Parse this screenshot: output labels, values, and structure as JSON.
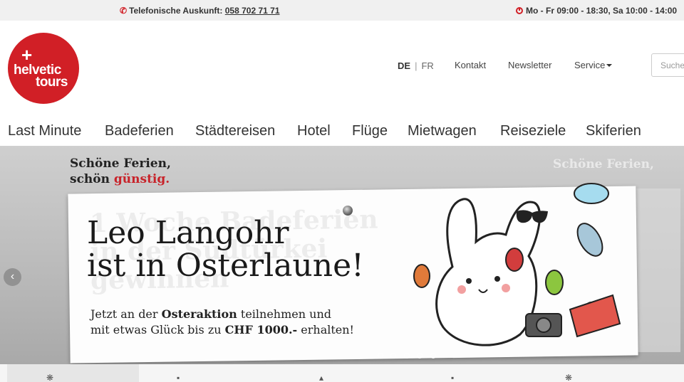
{
  "topbar": {
    "phone_label": "Telefonische Auskunft:",
    "phone_number": "058 702 71 71",
    "hours": "Mo - Fr 09:00 - 18:30, Sa 10:00 - 14:00"
  },
  "logo": {
    "plus": "+",
    "line1": "helvetic",
    "line2": "tours"
  },
  "header": {
    "lang_de": "DE",
    "lang_separator": "|",
    "lang_fr": "FR",
    "kontakt": "Kontakt",
    "newsletter": "Newsletter",
    "service": "Service",
    "search_placeholder": "Suche"
  },
  "nav": [
    "Last Minute",
    "Badeferien",
    "Städtereisen",
    "Hotel",
    "Flüge",
    "Mietwagen",
    "Reiseziele",
    "Skiferien"
  ],
  "hero": {
    "tagline_line1": "Schöne Ferien,",
    "tagline_line2_prefix": "schön ",
    "tagline_line2_accent": "günstig.",
    "headline_line1": "Leo Langohr",
    "headline_line2": "ist in Osterlaune!",
    "sub_part1": "Jetzt an der ",
    "sub_bold1": "Osteraktion",
    "sub_part2": " teilnehmen und",
    "sub_part3": "mit etwas Glück bis zu ",
    "sub_bold2": "CHF 1000.-",
    "sub_part4": " erhalten!",
    "bg_text_line1": "1 Woche Badeferien",
    "bg_text_line2": "in der Südtürkei",
    "bg_text_line3": "gewinnen",
    "ghost_tagline": "Schöne Ferien,",
    "prev_arrow": "‹"
  },
  "colors": {
    "brand_red": "#d11f26",
    "topbar_bg": "#f0f0f0"
  },
  "icons": [
    "phone-icon",
    "clock-icon",
    "caret-down-icon",
    "chevron-left-icon",
    "palm-tree-icon",
    "suitcase-icon",
    "city-icon",
    "hotel-icon",
    "beach-icon"
  ]
}
